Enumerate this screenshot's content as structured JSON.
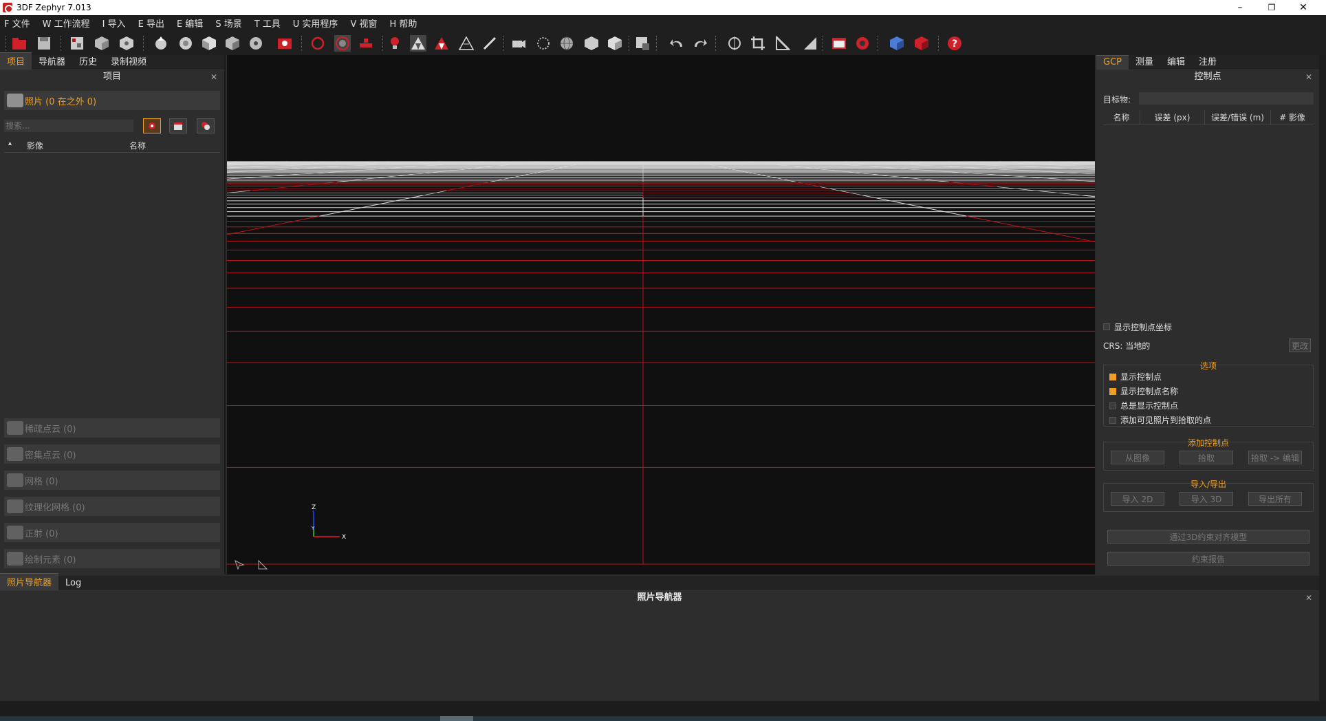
{
  "window": {
    "title": "3DF Zephyr 7.013",
    "minimize": "–",
    "maximize": "❐",
    "close": "✕"
  },
  "menu": [
    "F 文件",
    "W 工作流程",
    "I 导入",
    "E 导出",
    "E 编辑",
    "S 场景",
    "T 工具",
    "U 实用程序",
    "V 视窗",
    "H 帮助"
  ],
  "left_panel": {
    "tabs": [
      "项目",
      "导航器",
      "历史",
      "录制视频"
    ],
    "title": "项目",
    "photos_label": "照片 (0 在之外 0)",
    "search_placeholder": "搜索...",
    "columns": [
      "影像",
      "名称"
    ],
    "sections": [
      "稀疏点云 (0)",
      "密集点云 (0)",
      "网格 (0)",
      "纹理化网格 (0)",
      "正射 (0)",
      "绘制元素 (0)"
    ]
  },
  "right_panel": {
    "tabs": [
      "GCP",
      "测量",
      "编辑",
      "注册"
    ],
    "title": "控制点",
    "target_label": "目标物:",
    "columns": [
      "名称",
      "误差 (px)",
      "误差/错误 (m)",
      "# 影像"
    ],
    "show_coords_label": "显示控制点坐标",
    "crs_label": "CRS: 当地的",
    "change_button": "更改",
    "options_title": "选项",
    "options": [
      {
        "label": "显示控制点",
        "checked": true
      },
      {
        "label": "显示控制点名称",
        "checked": true
      },
      {
        "label": "总是显示控制点",
        "checked": false
      },
      {
        "label": "添加可见照片到拾取的点",
        "checked": false
      }
    ],
    "add_title": "添加控制点",
    "add_buttons": [
      "从图像",
      "拾取",
      "拾取 -> 编辑"
    ],
    "io_title": "导入/导出",
    "io_buttons": [
      "导入 2D",
      "导入 3D",
      "导出所有"
    ],
    "align_button": "通过3D约束对齐模型",
    "report_button": "约束报告"
  },
  "bottom_panel": {
    "tabs": [
      "照片导航器",
      "Log"
    ],
    "title": "照片导航器"
  },
  "viewport": {
    "axis_labels": [
      "Z",
      "Y",
      "X"
    ]
  },
  "colors": {
    "accent": "#f0a020",
    "grid_red": "#c0141c",
    "grid_white": "#d8d8d8"
  }
}
